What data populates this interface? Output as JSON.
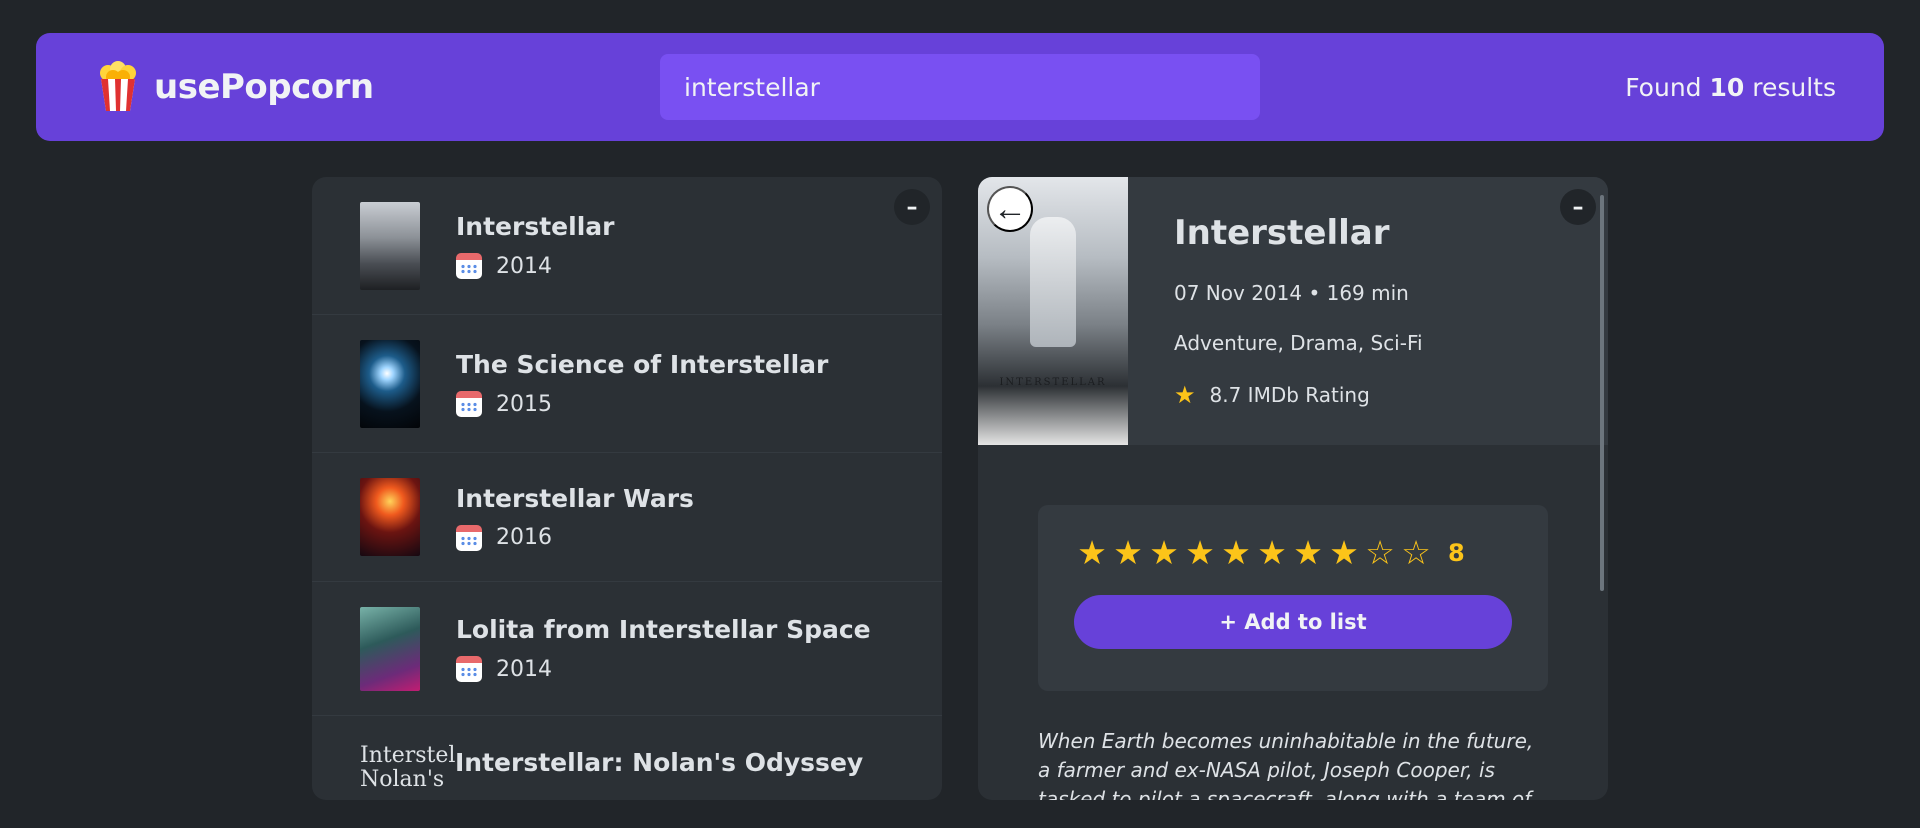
{
  "nav": {
    "logo_icon": "popcorn-icon",
    "logo_text": "usePopcorn",
    "search_value": "interstellar",
    "results_prefix": "Found",
    "results_count": "10",
    "results_suffix": "results"
  },
  "left_box": {
    "toggle_label": "–",
    "movies": [
      {
        "title": "Interstellar",
        "year": "2014"
      },
      {
        "title": "The Science of Interstellar",
        "year": "2015"
      },
      {
        "title": "Interstellar Wars",
        "year": "2016"
      },
      {
        "title": "Lolita from Interstellar Space",
        "year": "2014"
      },
      {
        "title": "Interstellar: Nolan's Odyssey",
        "year": "",
        "poster_alt": "Interstellar: Nolan's"
      }
    ]
  },
  "details": {
    "toggle_label": "–",
    "back_label": "←",
    "poster_text": "INTERSTELLAR",
    "title": "Interstellar",
    "released_runtime": "07 Nov 2014 • 169 min",
    "genre": "Adventure, Drama, Sci-Fi",
    "imdb_rating": "8.7 IMDb Rating",
    "user_rating": 8,
    "max_rating": 10,
    "user_rating_text": "8",
    "add_button_label": "+ Add to list",
    "plot": "When Earth becomes uninhabitable in the future, a farmer and ex-NASA pilot, Joseph Cooper, is tasked to pilot a spacecraft, along with a team of researchers, to"
  },
  "colors": {
    "background": "#212529",
    "primary": "#6741d9",
    "primary_light": "#7950f2",
    "star": "#fcc419"
  }
}
